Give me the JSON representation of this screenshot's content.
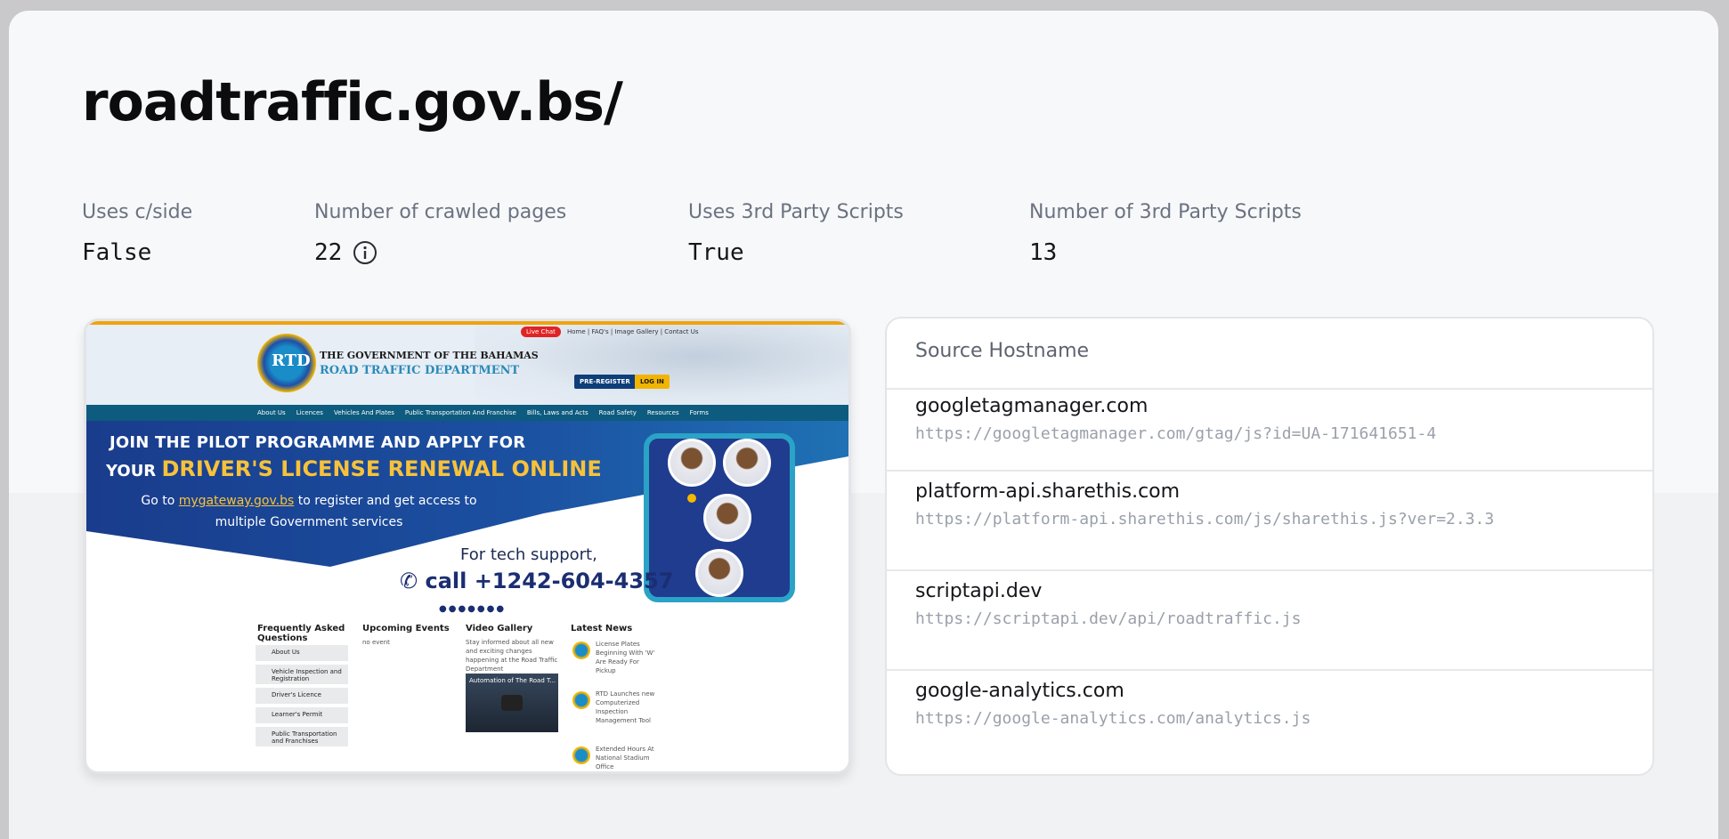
{
  "page": {
    "title": "roadtraffic.gov.bs/"
  },
  "stats": [
    {
      "label": "Uses c/side",
      "value": "False"
    },
    {
      "label": "Number of crawled pages",
      "value": "22",
      "icon": "info-icon"
    },
    {
      "label": "Uses 3rd Party Scripts",
      "value": "True"
    },
    {
      "label": "Number of 3rd Party Scripts",
      "value": "13"
    }
  ],
  "preview": {
    "logo_text": "RTD",
    "org_line1": "THE GOVERNMENT OF THE BAHAMAS",
    "org_line2": "ROAD TRAFFIC DEPARTMENT",
    "live_badge": "Live Chat",
    "top_links": "Home | FAQ's | Image Gallery | Contact Us",
    "preregister": "PRE-REGISTER",
    "login": "LOG IN",
    "nav": [
      "About Us",
      "Licences",
      "Vehicles And Plates",
      "Public Transportation And Franchise",
      "Bills, Laws and Acts",
      "Road Safety",
      "Resources",
      "Forms"
    ],
    "headline1": "JOIN THE PILOT PROGRAMME AND APPLY FOR",
    "headline2_prefix": "YOUR",
    "headline2_highlight": "DRIVER'S LICENSE RENEWAL ONLINE",
    "sub_prefix": "Go to",
    "sub_link": "mygateway.gov.bs",
    "sub_rest": "to register and get access to multiple Government services",
    "support": "For tech support,",
    "phone": "call +1242-604-4357",
    "dots": "●●●●●●●",
    "faq_title": "Frequently Asked Questions",
    "faq_items": [
      "About Us",
      "Vehicle Inspection and Registration",
      "Driver's Licence",
      "Learner's Permit",
      "Public Transportation and Franchises"
    ],
    "events_title": "Upcoming Events",
    "events_text": "no event",
    "video_title": "Video Gallery",
    "video_text": "Stay informed about all new and exciting changes happening at the Road Traffic Department",
    "video_caption": "Automation of The Road T...",
    "news_title": "Latest News",
    "news_items": [
      "License Plates Beginning With 'W' Are Ready For Pickup",
      "RTD Launches new Computerized Inspection Management Tool",
      "Extended Hours At National Stadium Office"
    ]
  },
  "sources": {
    "header": "Source Hostname",
    "rows": [
      {
        "host": "googletagmanager.com",
        "url": "https://googletagmanager.com/gtag/js?id=UA-171641651-4"
      },
      {
        "host": "platform-api.sharethis.com",
        "url": "https://platform-api.sharethis.com/js/sharethis.js?ver=2.3.3"
      },
      {
        "host": "scriptapi.dev",
        "url": "https://scriptapi.dev/api/roadtraffic.js"
      },
      {
        "host": "google-analytics.com",
        "url": "https://google-analytics.com/analytics.js"
      }
    ]
  },
  "colors": {
    "page_bg": "#f7f8fa",
    "title": "#0c0c0e",
    "label": "#6b7280",
    "url_gray": "#9aa0aa"
  }
}
